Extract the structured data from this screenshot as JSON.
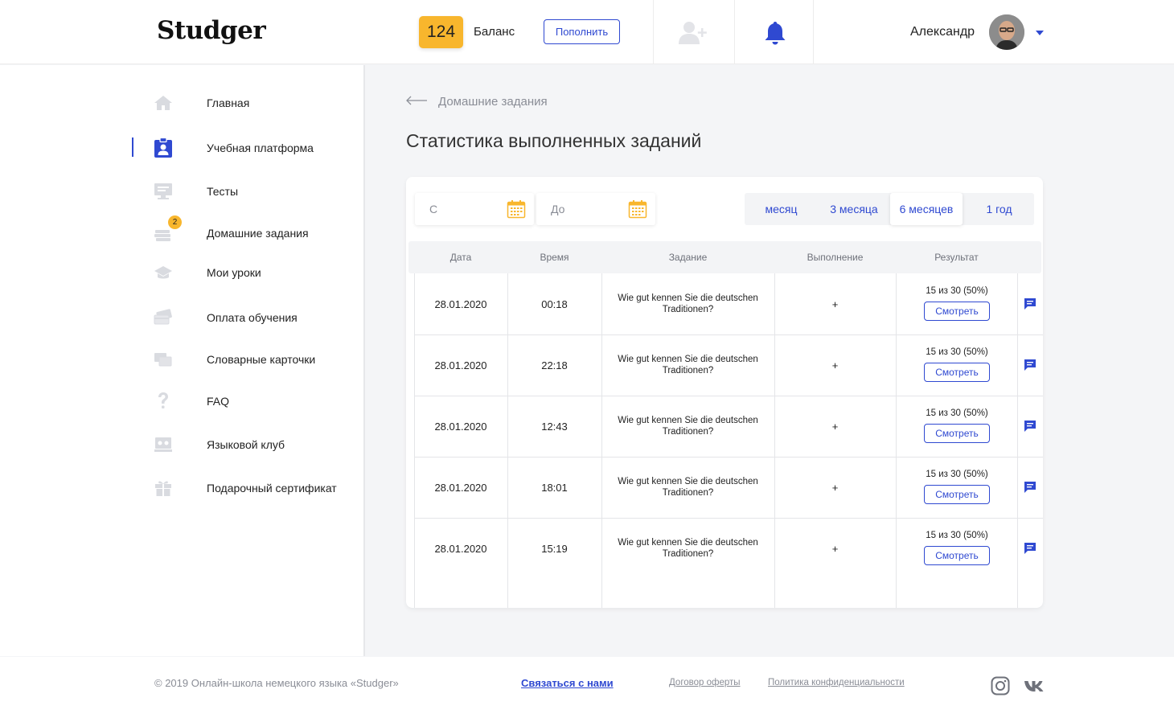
{
  "header": {
    "logo": "Studger",
    "balance_value": "124",
    "balance_label": "Баланс",
    "topup_label": "Пополнить",
    "username": "Александр",
    "icons": [
      "add-user-icon",
      "bell-icon"
    ]
  },
  "colors": {
    "accent": "#2f49d1",
    "badge": "#f8b62d"
  },
  "sidebar": {
    "items": [
      {
        "label": "Главная",
        "icon": "home-icon"
      },
      {
        "label": "Учебная платформа",
        "icon": "clipboard-user-icon",
        "active": true
      },
      {
        "label": "Тесты",
        "icon": "monitor-icon"
      },
      {
        "label": "Домашние задания",
        "icon": "homework-stack-icon",
        "badge": "2"
      },
      {
        "label": "Мои уроки",
        "icon": "graduation-cap-icon"
      },
      {
        "label": "Оплата обучения",
        "icon": "cards-icon"
      },
      {
        "label": "Словарные карточки",
        "icon": "flashcards-icon"
      },
      {
        "label": "FAQ",
        "icon": "question-icon"
      },
      {
        "label": "Языковой клуб",
        "icon": "language-club-icon"
      },
      {
        "label": "Подарочный сертификат",
        "icon": "gift-icon"
      }
    ]
  },
  "main": {
    "breadcrumb": "Домашние задания",
    "title": "Статистика выполненных заданий",
    "filters": {
      "from_placeholder": "С",
      "to_placeholder": "До",
      "periods": [
        "месяц",
        "3 месяца",
        "6 месяцев",
        "1 год"
      ],
      "active_period": "6 месяцев"
    },
    "table": {
      "columns": [
        "Дата",
        "Время",
        "Задание",
        "Выполнение",
        "Результат"
      ],
      "view_label": "Смотреть",
      "rows": [
        {
          "date": "28.01.2020",
          "time": "00:18",
          "task": "Wie gut kennen Sie die deutschen Traditionen?",
          "done": "+",
          "result": "15 из 30 (50%)"
        },
        {
          "date": "28.01.2020",
          "time": "22:18",
          "task": "Wie gut kennen Sie die deutschen Traditionen?",
          "done": "+",
          "result": "15 из 30 (50%)"
        },
        {
          "date": "28.01.2020",
          "time": "12:43",
          "task": "Wie gut kennen Sie die deutschen Traditionen?",
          "done": "+",
          "result": "15 из 30 (50%)"
        },
        {
          "date": "28.01.2020",
          "time": "18:01",
          "task": "Wie gut kennen Sie die deutschen Traditionen?",
          "done": "+",
          "result": "15 из 30 (50%)"
        },
        {
          "date": "28.01.2020",
          "time": "15:19",
          "task": "Wie gut kennen Sie die deutschen Traditionen?",
          "done": "+",
          "result": "15 из 30 (50%)"
        }
      ]
    }
  },
  "footer": {
    "copyright": "© 2019 Онлайн-школа немецкого языка «Studger»",
    "contact": "Связаться с нами",
    "offer": "Договор оферты",
    "privacy": "Политика конфиденциальности",
    "social": [
      "instagram-icon",
      "vk-icon"
    ]
  }
}
